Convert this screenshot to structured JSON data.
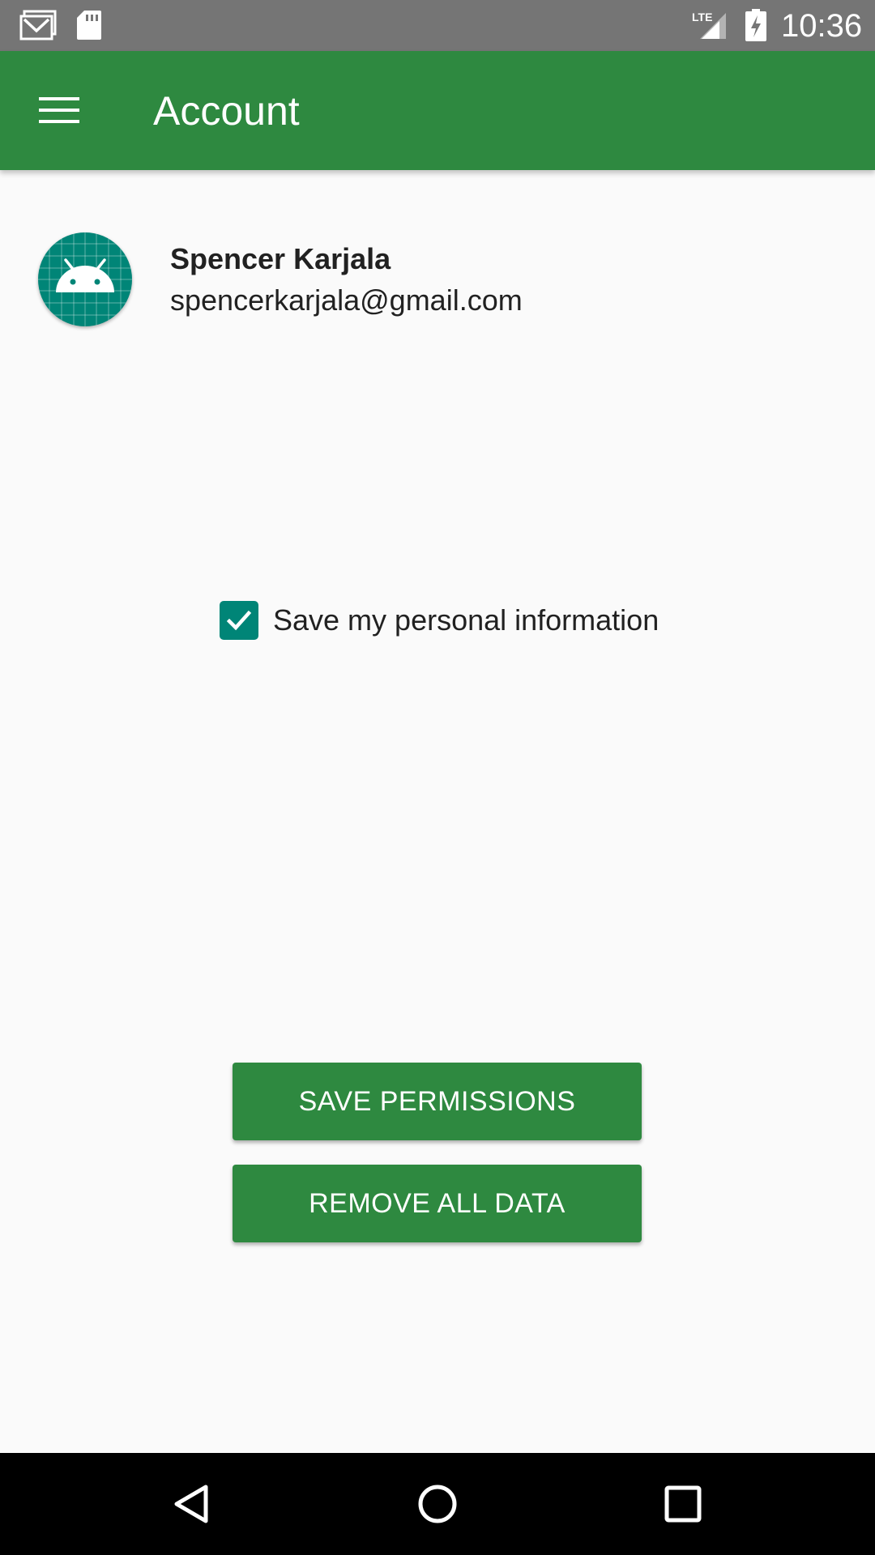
{
  "status_bar": {
    "time": "10:36",
    "network_label": "LTE",
    "icons": [
      "gmail-icon",
      "sd-card-icon",
      "lte-signal-icon",
      "battery-charging-icon"
    ]
  },
  "app_bar": {
    "title": "Account",
    "menu_icon": "hamburger-menu-icon",
    "background_color": "#2e8940"
  },
  "profile": {
    "name": "Spencer Karjala",
    "email": "spencerkarjala@gmail.com",
    "avatar_icon": "android-robot-icon",
    "avatar_color": "#008577"
  },
  "consent": {
    "label": "Save my personal information",
    "checked": true
  },
  "actions": {
    "save_label": "SAVE PERMISSIONS",
    "remove_label": "REMOVE ALL DATA"
  },
  "nav_bar": {
    "icons": [
      "back-icon",
      "home-icon",
      "recents-icon"
    ]
  }
}
